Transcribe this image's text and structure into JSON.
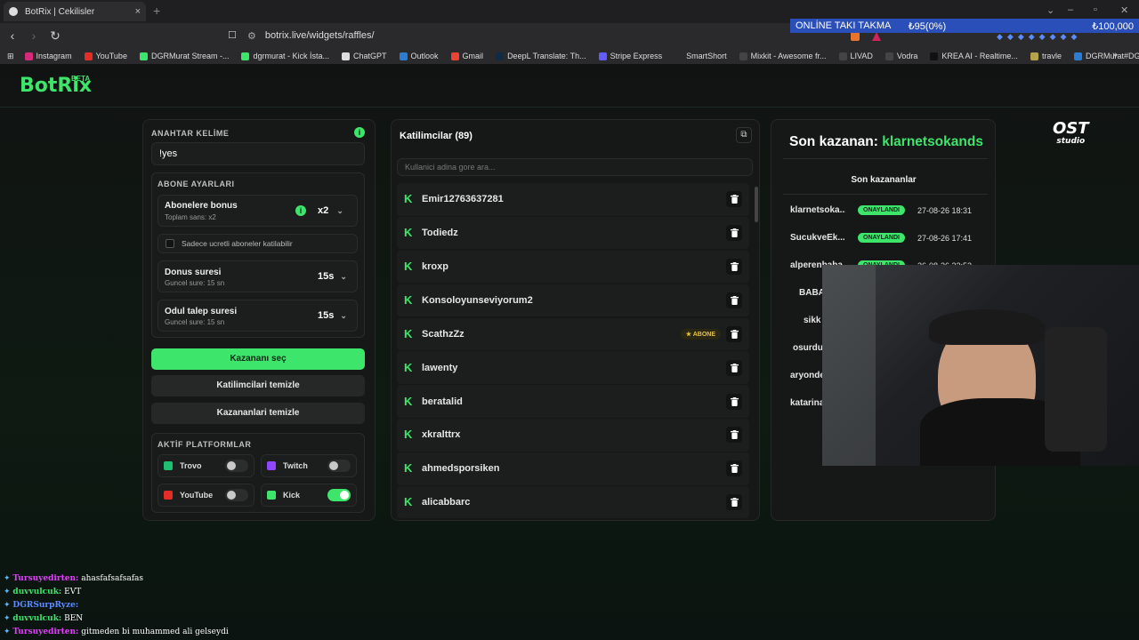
{
  "browser": {
    "tab_title": "BotRix | Cekilisler",
    "tab_close": "×",
    "new_tab": "+",
    "url": "botrix.live/widgets/raffles/",
    "bookmarks": [
      {
        "label": "Instagram",
        "color": "#d6297a"
      },
      {
        "label": "YouTube",
        "color": "#e52d27"
      },
      {
        "label": "DGRMurat Stream -...",
        "color": "#3ee56b"
      },
      {
        "label": "dgrmurat - Kick İsta...",
        "color": "#3ee56b"
      },
      {
        "label": "ChatGPT",
        "color": "#dddddd"
      },
      {
        "label": "Outlook",
        "color": "#2b7cd3"
      },
      {
        "label": "Gmail",
        "color": "#ea4335"
      },
      {
        "label": "DeepL Translate: Th...",
        "color": "#0f2b46"
      },
      {
        "label": "Stripe Express",
        "color": "#635bff"
      },
      {
        "label": "SmartShort",
        "color": "#2a2a2c"
      },
      {
        "label": "Mixkit - Awesome fr...",
        "color": "#444444"
      },
      {
        "label": "LIVAD",
        "color": "#444444"
      },
      {
        "label": "Vodra",
        "color": "#444444"
      },
      {
        "label": "KREA AI - Realtime...",
        "color": "#111111"
      },
      {
        "label": "travle",
        "color": "#b7a34a"
      },
      {
        "label": "DGRMurat#DGR (E...",
        "color": "#2b7cd3"
      }
    ],
    "bookmarks_more": "»"
  },
  "ticker": {
    "label": "ONLİNE TAKI TAKMA",
    "value1": "₺95(0%)",
    "value2": "₺100,000"
  },
  "brand": {
    "name": "BotRix",
    "badge": "BETA",
    "accent": "#3ee56b"
  },
  "left": {
    "keyword_label": "ANAHTAR KELİME",
    "keyword_value": "!yes",
    "sub_settings_label": "ABONE AYARLARI",
    "bonus_title": "Abonelere bonus",
    "bonus_sub": "Toplam sans: x2",
    "bonus_value": "x2",
    "paid_only": "Sadece ucretli aboneler katilabilir",
    "duration_title": "Donus suresi",
    "duration_sub": "Guncel sure: 15 sn",
    "duration_value": "15s",
    "claim_title": "Odul talep suresi",
    "claim_sub": "Guncel sure: 15 sn",
    "claim_value": "15s",
    "pick_winner": "Kazananı seç",
    "clear_participants": "Katilimcilari temizle",
    "clear_winners": "Kazananlari temizle",
    "platforms_label": "AKTİF PLATFORMLAR",
    "platforms": [
      {
        "name": "Trovo",
        "on": false,
        "color": "#1fbf72"
      },
      {
        "name": "Twitch",
        "on": false,
        "color": "#9146ff"
      },
      {
        "name": "YouTube",
        "on": false,
        "color": "#e52d27"
      },
      {
        "name": "Kick",
        "on": true,
        "color": "#3ee56b"
      }
    ]
  },
  "participants": {
    "title": "Katilimcilar (89)",
    "search_placeholder": "Kullanici adina gore ara...",
    "sub_badge": "★ ABONE",
    "list": [
      {
        "name": "Emir12763637281",
        "sub": false
      },
      {
        "name": "Todiedz",
        "sub": false
      },
      {
        "name": "kroxp",
        "sub": false
      },
      {
        "name": "Konsoloyunseviyorum2",
        "sub": false
      },
      {
        "name": "ScathzZz",
        "sub": true
      },
      {
        "name": "lawenty",
        "sub": false
      },
      {
        "name": "beratalid",
        "sub": false
      },
      {
        "name": "xkralttrx",
        "sub": false
      },
      {
        "name": "ahmedsporsiken",
        "sub": false
      },
      {
        "name": "alicabbarc",
        "sub": false
      }
    ]
  },
  "winners": {
    "last_winner_label": "Son kazanan:",
    "last_winner_name": "klarnetsokands",
    "list_title": "Son kazananlar",
    "status": "ONAYLANDI",
    "list": [
      {
        "name": "klarnetsoka...",
        "date": "27-08-26 18:31",
        "pill": true
      },
      {
        "name": "SucukveEk...",
        "date": "27-08-26 17:41",
        "pill": true
      },
      {
        "name": "alperenbaba",
        "date": "26-08-26 22:52",
        "pill": true
      },
      {
        "name": "BABA",
        "date": "",
        "pill": false
      },
      {
        "name": "sikk",
        "date": "",
        "pill": false
      },
      {
        "name": "osurdu",
        "date": "",
        "pill": false
      },
      {
        "name": "aryonde",
        "date": "",
        "pill": false
      },
      {
        "name": "katarina",
        "date": "",
        "pill": false
      }
    ]
  },
  "sponsor_logo": {
    "line1": "OST",
    "line2": "studio"
  },
  "chat": [
    {
      "user": "Tursuyedirten:",
      "msg": "ahasfafsafsafas",
      "color": "#e040fb"
    },
    {
      "user": "duvvulcuk:",
      "msg": "EVT",
      "color": "#3ee56b"
    },
    {
      "user": "DGRSurpRyze:",
      "msg": "",
      "color": "#5b8cff"
    },
    {
      "user": "duvvulcuk:",
      "msg": "BEN",
      "color": "#3ee56b"
    },
    {
      "user": "Tursuyedirten:",
      "msg": "gitmeden bi muhammed ali gelseydi",
      "color": "#e040fb"
    }
  ]
}
